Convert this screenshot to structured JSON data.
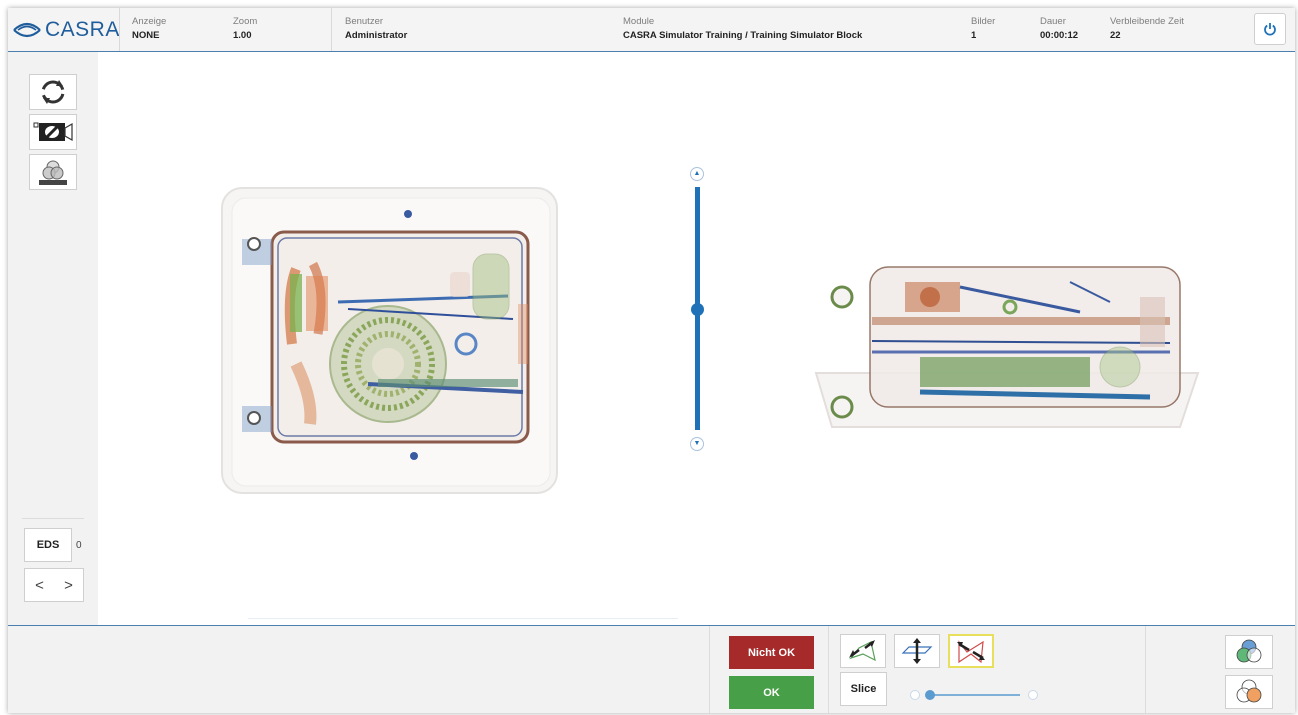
{
  "header": {
    "logo_text": "CASRA",
    "fields": {
      "anzeige": {
        "label": "Anzeige",
        "value": "NONE"
      },
      "zoom": {
        "label": "Zoom",
        "value": "1.00"
      },
      "benutzer": {
        "label": "Benutzer",
        "value": "Administrator"
      },
      "module": {
        "label": "Module",
        "value": "CASRA Simulator Training / Training Simulator Block"
      },
      "bilder": {
        "label": "Bilder",
        "value": "1"
      },
      "dauer": {
        "label": "Dauer",
        "value": "00:00:12"
      },
      "verbleibende": {
        "label": "Verbleibende Zeit",
        "value": "22"
      }
    },
    "power_icon": "power-icon"
  },
  "sidebar": {
    "tools": [
      "rotate-icon",
      "camera-icon",
      "color-filter-icon"
    ],
    "eds_label": "EDS",
    "eds_count": "0",
    "prev_label": "<",
    "next_label": ">"
  },
  "viewer": {
    "slice_slider_position": 0.5,
    "views": [
      "top-view xray scan of suitcase",
      "side-view xray scan of suitcase"
    ]
  },
  "footer": {
    "not_ok_label": "Nicht OK",
    "ok_label": "OK",
    "slice_label": "Slice",
    "view_buttons": [
      "view-front-icon",
      "view-top-icon",
      "view-side-icon"
    ],
    "active_view": "view-side-icon",
    "colors": {
      "not_ok": "#a72a2a",
      "ok": "#47a047",
      "accent": "#1f72b8"
    }
  }
}
